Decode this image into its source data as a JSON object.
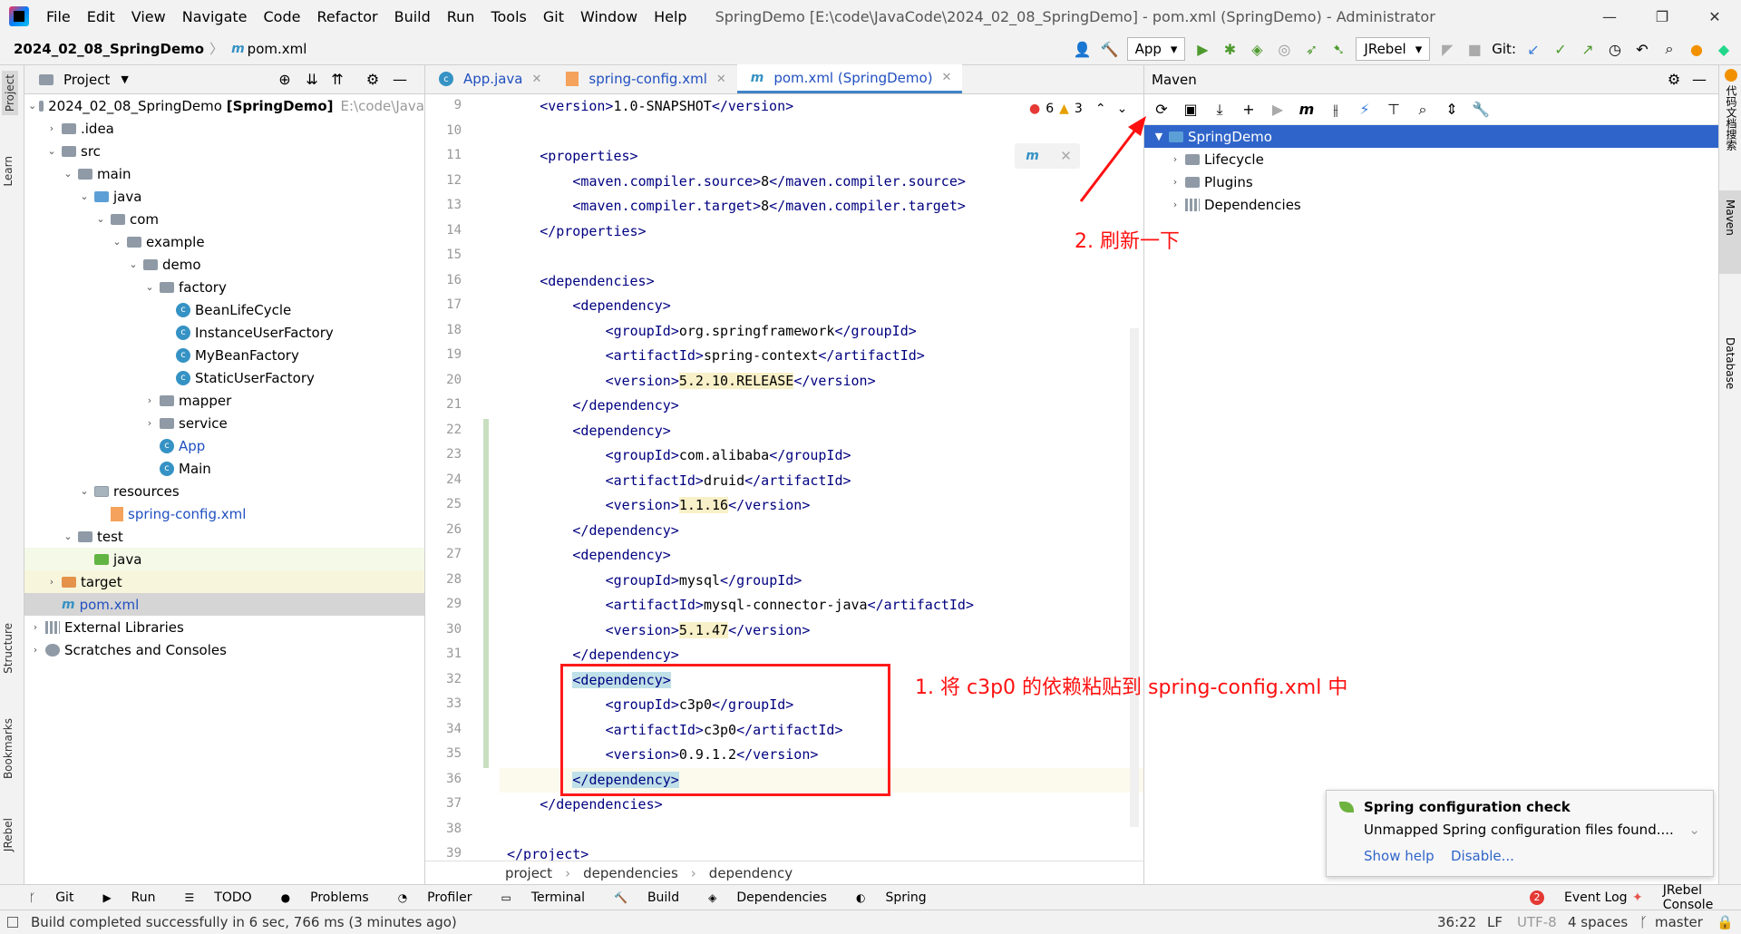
{
  "window": {
    "menu": [
      "File",
      "Edit",
      "View",
      "Navigate",
      "Code",
      "Refactor",
      "Build",
      "Run",
      "Tools",
      "Git",
      "Window",
      "Help"
    ],
    "title": "SpringDemo [E:\\code\\JavaCode\\2024_02_08_SpringDemo] - pom.xml (SpringDemo) - Administrator",
    "controls": [
      "minimize",
      "restore",
      "close"
    ]
  },
  "navbar": {
    "project": "2024_02_08_SpringDemo",
    "file": "pom.xml",
    "run_config": "App",
    "jrebel": "JRebel",
    "git_label": "Git:"
  },
  "project_panel": {
    "title": "Project",
    "tree": [
      {
        "label": "2024_02_08_SpringDemo [SpringDemo]",
        "suffix": "E:\\code\\Java",
        "level": 0,
        "icon": "folder",
        "arrow": "down"
      },
      {
        "label": ".idea",
        "level": 1,
        "icon": "folder",
        "arrow": "right"
      },
      {
        "label": "src",
        "level": 1,
        "icon": "folder",
        "arrow": "down"
      },
      {
        "label": "main",
        "level": 2,
        "icon": "folder",
        "arrow": "down"
      },
      {
        "label": "java",
        "level": 3,
        "icon": "folder-blue",
        "arrow": "down"
      },
      {
        "label": "com",
        "level": 4,
        "icon": "folder",
        "arrow": "down"
      },
      {
        "label": "example",
        "level": 5,
        "icon": "folder",
        "arrow": "down"
      },
      {
        "label": "demo",
        "level": 6,
        "icon": "folder",
        "arrow": "down"
      },
      {
        "label": "factory",
        "level": 7,
        "icon": "folder",
        "arrow": "down"
      },
      {
        "label": "BeanLifeCycle",
        "level": 8,
        "icon": "class"
      },
      {
        "label": "InstanceUserFactory",
        "level": 8,
        "icon": "class"
      },
      {
        "label": "MyBeanFactory",
        "level": 8,
        "icon": "class"
      },
      {
        "label": "StaticUserFactory",
        "level": 8,
        "icon": "class"
      },
      {
        "label": "mapper",
        "level": 7,
        "icon": "folder",
        "arrow": "right"
      },
      {
        "label": "service",
        "level": 7,
        "icon": "folder",
        "arrow": "right"
      },
      {
        "label": "App",
        "level": 7,
        "icon": "class-run",
        "color": "#2050c0"
      },
      {
        "label": "Main",
        "level": 7,
        "icon": "class-run"
      },
      {
        "label": "resources",
        "level": 3,
        "icon": "folder-res",
        "arrow": "down"
      },
      {
        "label": "spring-config.xml",
        "level": 4,
        "icon": "xml",
        "color": "#2050c0"
      },
      {
        "label": "test",
        "level": 2,
        "icon": "folder",
        "arrow": "down"
      },
      {
        "label": "java",
        "level": 3,
        "icon": "folder-green",
        "bg": "#f5f9e8"
      },
      {
        "label": "target",
        "level": 1,
        "icon": "folder-orange",
        "arrow": "right",
        "bg": "#f7f6dc"
      },
      {
        "label": "pom.xml",
        "level": 1,
        "icon": "maven",
        "color": "#2050c0",
        "bg": "#d5d5d5"
      },
      {
        "label": "External Libraries",
        "level": 0,
        "icon": "lib",
        "arrow": "right"
      },
      {
        "label": "Scratches and Consoles",
        "level": 0,
        "icon": "scratch",
        "arrow": "right"
      }
    ]
  },
  "editor": {
    "tabs": [
      {
        "label": "App.java",
        "active": false
      },
      {
        "label": "spring-config.xml",
        "active": false
      },
      {
        "label": "pom.xml (SpringDemo)",
        "active": true
      }
    ],
    "inspection": {
      "errors": "6",
      "warnings": "3"
    },
    "lines": [
      {
        "n": "9",
        "indent": 2,
        "parts": [
          [
            "t",
            "<version>"
          ],
          [
            "x",
            "1.0-SNAPSHOT"
          ],
          [
            "t",
            "</version>"
          ]
        ]
      },
      {
        "n": "10",
        "indent": 0,
        "parts": []
      },
      {
        "n": "11",
        "indent": 2,
        "parts": [
          [
            "t",
            "<properties>"
          ]
        ]
      },
      {
        "n": "12",
        "indent": 4,
        "parts": [
          [
            "t",
            "<maven.compiler.source>"
          ],
          [
            "x",
            "8"
          ],
          [
            "t",
            "</maven.compiler.source>"
          ]
        ]
      },
      {
        "n": "13",
        "indent": 4,
        "parts": [
          [
            "t",
            "<maven.compiler.target>"
          ],
          [
            "x",
            "8"
          ],
          [
            "t",
            "</maven.compiler.target>"
          ]
        ]
      },
      {
        "n": "14",
        "indent": 2,
        "parts": [
          [
            "t",
            "</properties>"
          ]
        ]
      },
      {
        "n": "15",
        "indent": 0,
        "parts": []
      },
      {
        "n": "16",
        "indent": 2,
        "parts": [
          [
            "t",
            "<dependencies>"
          ]
        ]
      },
      {
        "n": "17",
        "indent": 4,
        "parts": [
          [
            "t",
            "<dependency>"
          ]
        ]
      },
      {
        "n": "18",
        "indent": 6,
        "parts": [
          [
            "t",
            "<groupId>"
          ],
          [
            "x",
            "org.springframework"
          ],
          [
            "t",
            "</groupId>"
          ]
        ]
      },
      {
        "n": "19",
        "indent": 6,
        "parts": [
          [
            "t",
            "<artifactId>"
          ],
          [
            "x",
            "spring-context"
          ],
          [
            "t",
            "</artifactId>"
          ]
        ]
      },
      {
        "n": "20",
        "indent": 6,
        "parts": [
          [
            "t",
            "<version>"
          ],
          [
            "h",
            "5.2.10.RELEASE"
          ],
          [
            "t",
            "</version>"
          ]
        ]
      },
      {
        "n": "21",
        "indent": 4,
        "parts": [
          [
            "t",
            "</dependency>"
          ]
        ]
      },
      {
        "n": "22",
        "indent": 4,
        "parts": [
          [
            "t",
            "<dependency>"
          ]
        ]
      },
      {
        "n": "23",
        "indent": 6,
        "parts": [
          [
            "t",
            "<groupId>"
          ],
          [
            "x",
            "com.alibaba"
          ],
          [
            "t",
            "</groupId>"
          ]
        ]
      },
      {
        "n": "24",
        "indent": 6,
        "parts": [
          [
            "t",
            "<artifactId>"
          ],
          [
            "x",
            "druid"
          ],
          [
            "t",
            "</artifactId>"
          ]
        ]
      },
      {
        "n": "25",
        "indent": 6,
        "parts": [
          [
            "t",
            "<version>"
          ],
          [
            "h",
            "1.1.16"
          ],
          [
            "t",
            "</version>"
          ]
        ]
      },
      {
        "n": "26",
        "indent": 4,
        "parts": [
          [
            "t",
            "</dependency>"
          ]
        ]
      },
      {
        "n": "27",
        "indent": 4,
        "parts": [
          [
            "t",
            "<dependency>"
          ]
        ]
      },
      {
        "n": "28",
        "indent": 6,
        "parts": [
          [
            "t",
            "<groupId>"
          ],
          [
            "x",
            "mysql"
          ],
          [
            "t",
            "</groupId>"
          ]
        ]
      },
      {
        "n": "29",
        "indent": 6,
        "parts": [
          [
            "t",
            "<artifactId>"
          ],
          [
            "x",
            "mysql-connector-java"
          ],
          [
            "t",
            "</artifactId>"
          ]
        ]
      },
      {
        "n": "30",
        "indent": 6,
        "parts": [
          [
            "t",
            "<version>"
          ],
          [
            "h",
            "5.1.47"
          ],
          [
            "t",
            "</version>"
          ]
        ]
      },
      {
        "n": "31",
        "indent": 4,
        "parts": [
          [
            "t",
            "</dependency>"
          ]
        ]
      },
      {
        "n": "32",
        "indent": 4,
        "parts": [
          [
            "s",
            "<dependency>"
          ]
        ]
      },
      {
        "n": "33",
        "indent": 6,
        "parts": [
          [
            "t",
            "<groupId>"
          ],
          [
            "x",
            "c3p0"
          ],
          [
            "t",
            "</groupId>"
          ]
        ]
      },
      {
        "n": "34",
        "indent": 6,
        "parts": [
          [
            "t",
            "<artifactId>"
          ],
          [
            "x",
            "c3p0"
          ],
          [
            "t",
            "</artifactId>"
          ]
        ]
      },
      {
        "n": "35",
        "indent": 6,
        "parts": [
          [
            "t",
            "<version>"
          ],
          [
            "x",
            "0.9.1.2"
          ],
          [
            "t",
            "</version>"
          ]
        ]
      },
      {
        "n": "36",
        "indent": 4,
        "parts": [
          [
            "s",
            "</dependency>"
          ]
        ],
        "current": true
      },
      {
        "n": "37",
        "indent": 2,
        "parts": [
          [
            "t",
            "</dependencies>"
          ]
        ]
      },
      {
        "n": "38",
        "indent": 0,
        "parts": []
      },
      {
        "n": "39",
        "indent": 0,
        "parts": [
          [
            "t",
            "</project>"
          ]
        ]
      }
    ],
    "breadcrumb": [
      "project",
      "dependencies",
      "dependency"
    ]
  },
  "maven": {
    "title": "Maven",
    "root": "SpringDemo",
    "children": [
      "Lifecycle",
      "Plugins",
      "Dependencies"
    ]
  },
  "right_strip": [
    "代码文档搜索",
    "Maven",
    "Database"
  ],
  "left_strip": [
    "Project",
    "Learn",
    "Structure",
    "Bookmarks",
    "JRebel"
  ],
  "annotations": {
    "step1": "1. 将 c3p0 的依赖粘贴到 spring-config.xml 中",
    "step2": "2. 刷新一下"
  },
  "popup": {
    "title": "Spring configuration check",
    "body": "Unmapped Spring configuration files found....",
    "link1": "Show help",
    "link2": "Disable..."
  },
  "bottom_tabs": [
    "Git",
    "Run",
    "TODO",
    "Problems",
    "Profiler",
    "Terminal",
    "Build",
    "Dependencies",
    "Spring"
  ],
  "bottom_right": {
    "event_log": "Event Log",
    "event_count": "2",
    "jrebel_console": "JRebel Console"
  },
  "status": {
    "message": "Build completed successfully in 6 sec, 766 ms (3 minutes ago)",
    "position": "36:22",
    "line_sep": "LF",
    "encoding": "UTF-8",
    "indent": "4 spaces",
    "branch": "master"
  },
  "colors": {
    "accent": "#2f65ca",
    "annotation": "#ff1010",
    "tag": "#000080",
    "selection": "#bfe0e8"
  }
}
